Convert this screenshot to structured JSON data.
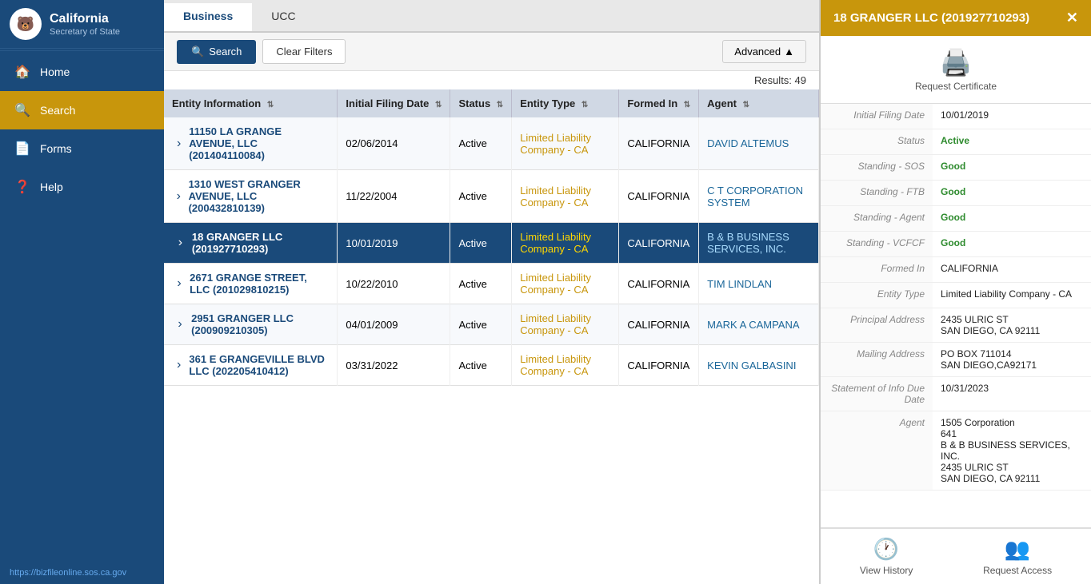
{
  "sidebar": {
    "title": "California",
    "subtitle": "Secretary of State",
    "logo_char": "🔵",
    "items": [
      {
        "id": "home",
        "label": "Home",
        "icon": "🏠",
        "active": false
      },
      {
        "id": "search",
        "label": "Search",
        "icon": "🔍",
        "active": true
      },
      {
        "id": "forms",
        "label": "Forms",
        "icon": "📄",
        "active": false
      },
      {
        "id": "help",
        "label": "Help",
        "icon": "❓",
        "active": false
      }
    ],
    "url": "https://bizfileonline.sos.ca.gov"
  },
  "tabs": [
    {
      "id": "business",
      "label": "Business",
      "active": true
    },
    {
      "id": "ucc",
      "label": "UCC",
      "active": false
    }
  ],
  "search_btn": "Search",
  "clear_btn": "Clear Filters",
  "advanced_btn": "Advanced",
  "results_count": "Results: 49",
  "table": {
    "headers": [
      {
        "id": "entity-info",
        "label": "Entity Information"
      },
      {
        "id": "initial-filing",
        "label": "Initial Filing Date"
      },
      {
        "id": "status",
        "label": "Status"
      },
      {
        "id": "entity-type",
        "label": "Entity Type"
      },
      {
        "id": "formed-in",
        "label": "Formed In"
      },
      {
        "id": "agent",
        "label": "Agent"
      }
    ],
    "rows": [
      {
        "name": "11150 LA GRANGE AVENUE, LLC (201404110084)",
        "filing_date": "02/06/2014",
        "status": "Active",
        "entity_type": "Limited Liability Company - CA",
        "formed_in": "CALIFORNIA",
        "agent": "DAVID ALTEMUS",
        "selected": false
      },
      {
        "name": "1310 WEST GRANGER AVENUE, LLC (200432810139)",
        "filing_date": "11/22/2004",
        "status": "Active",
        "entity_type": "Limited Liability Company - CA",
        "formed_in": "CALIFORNIA",
        "agent": "C T CORPORATION SYSTEM",
        "selected": false
      },
      {
        "name": "18 GRANGER LLC (201927710293)",
        "filing_date": "10/01/2019",
        "status": "Active",
        "entity_type": "Limited Liability Company - CA",
        "formed_in": "CALIFORNIA",
        "agent": "B & B BUSINESS SERVICES, INC.",
        "selected": true
      },
      {
        "name": "2671 GRANGE STREET, LLC (201029810215)",
        "filing_date": "10/22/2010",
        "status": "Active",
        "entity_type": "Limited Liability Company - CA",
        "formed_in": "CALIFORNIA",
        "agent": "TIM LINDLAN",
        "selected": false
      },
      {
        "name": "2951 GRANGER LLC (200909210305)",
        "filing_date": "04/01/2009",
        "status": "Active",
        "entity_type": "Limited Liability Company - CA",
        "formed_in": "CALIFORNIA",
        "agent": "MARK A CAMPANA",
        "selected": false
      },
      {
        "name": "361 E GRANGEVILLE BLVD LLC (202205410412)",
        "filing_date": "03/31/2022",
        "status": "Active",
        "entity_type": "Limited Liability Company - CA",
        "formed_in": "CALIFORNIA",
        "agent": "KEVIN GALBASINI",
        "selected": false
      }
    ]
  },
  "panel": {
    "title": "18 GRANGER LLC (201927710293)",
    "cert_label": "Request Certificate",
    "details": [
      {
        "label": "Initial Filing Date",
        "value": "10/01/2019",
        "class": ""
      },
      {
        "label": "Status",
        "value": "Active",
        "class": "active-val"
      },
      {
        "label": "Standing - SOS",
        "value": "Good",
        "class": "good"
      },
      {
        "label": "Standing - FTB",
        "value": "Good",
        "class": "good"
      },
      {
        "label": "Standing - Agent",
        "value": "Good",
        "class": "good"
      },
      {
        "label": "Standing - VCFCF",
        "value": "Good",
        "class": "good"
      },
      {
        "label": "Formed In",
        "value": "CALIFORNIA",
        "class": ""
      },
      {
        "label": "Entity Type",
        "value": "Limited Liability Company - CA",
        "class": ""
      },
      {
        "label": "Principal Address",
        "value": "2435 ULRIC ST\nSAN DIEGO, CA 92111",
        "class": ""
      },
      {
        "label": "Mailing Address",
        "value": "PO BOX 711014\nSAN DIEGO,CA92171",
        "class": ""
      },
      {
        "label": "Statement of Info Due Date",
        "value": "10/31/2023",
        "class": ""
      },
      {
        "label": "Agent",
        "value": "1505 Corporation\n641\nB & B BUSINESS SERVICES, INC.\n2435 ULRIC ST\nSAN DIEGO, CA  92111",
        "class": ""
      }
    ],
    "footer_actions": [
      {
        "id": "view-history",
        "label": "View History",
        "icon": "🕐"
      },
      {
        "id": "request-access",
        "label": "Request Access",
        "icon": "👥"
      }
    ]
  }
}
